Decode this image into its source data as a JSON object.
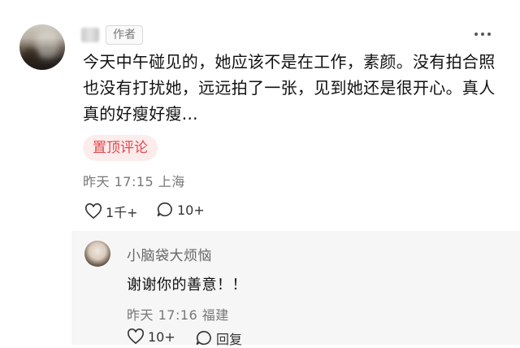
{
  "comment": {
    "author_badge": "作者",
    "text": "今天中午碰见的，她应该不是在工作，素颜。没有拍合照也没有打扰她，远远拍了一张，见到她还是很开心。真人真的好瘦好瘦...",
    "pinned_label": "置顶评论",
    "time": "昨天 17:15",
    "location": "上海",
    "likes": "1千+",
    "replies": "10+"
  },
  "reply": {
    "username": "小脑袋大烦恼",
    "text": "谢谢你的善意！！",
    "time": "昨天 17:16",
    "location": "福建",
    "likes": "10+",
    "favorites": "回复"
  },
  "colors": {
    "pinned_bg": "#fdecec",
    "pinned_text": "#e2474b",
    "meta_text": "#777777"
  },
  "icons": [
    "more-icon",
    "heart-icon",
    "comment-icon",
    "star-icon"
  ]
}
